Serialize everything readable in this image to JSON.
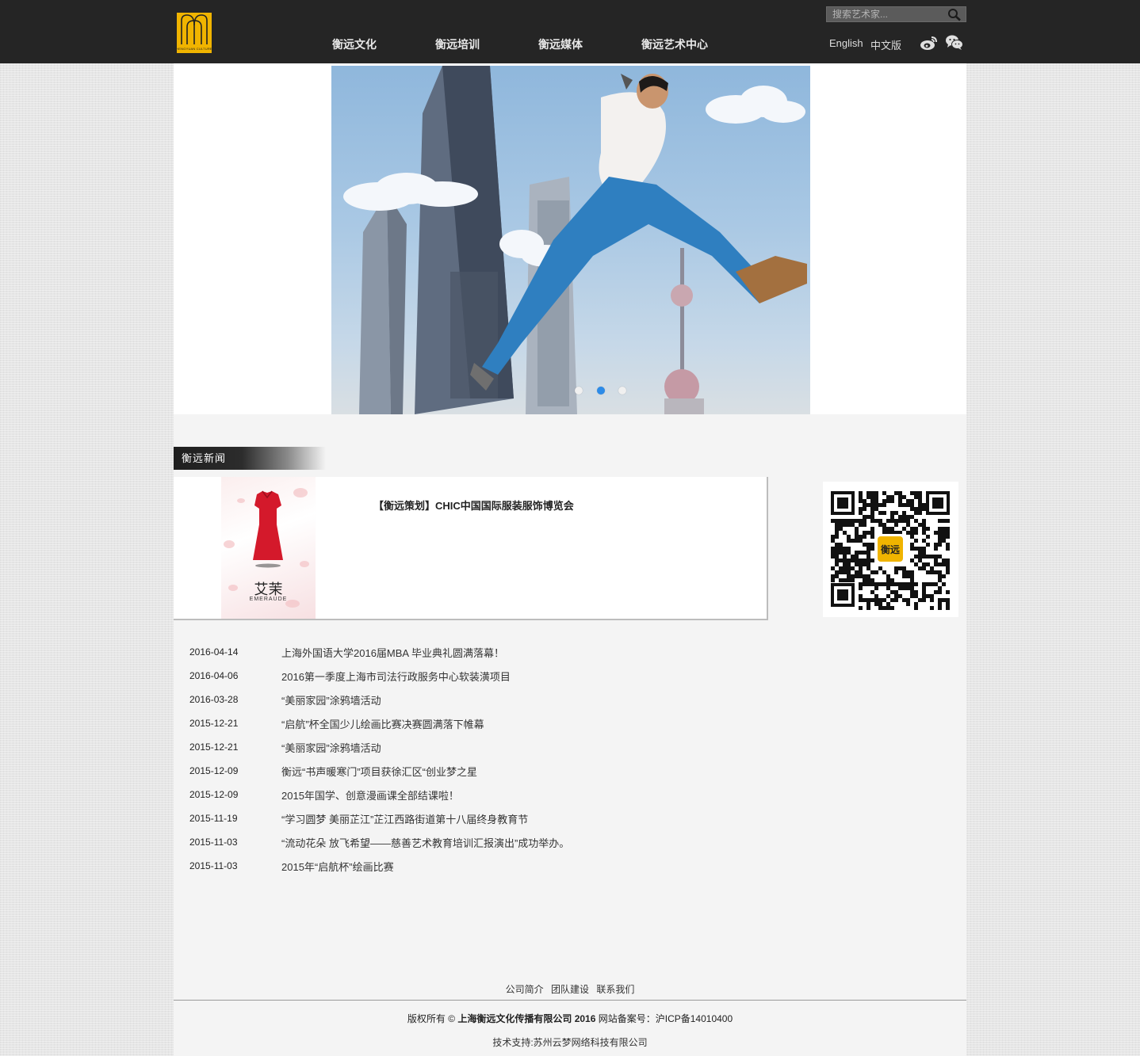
{
  "header": {
    "logo_text": "HENGYUAN CULTURE",
    "nav": [
      "衡远文化",
      "衡远培训",
      "衡远媒体",
      "衡远艺术中心"
    ],
    "search_placeholder": "搜索艺术家...",
    "lang_en": "English",
    "lang_cn": "中文版",
    "social_icons": [
      "weibo-icon",
      "wechat-icon"
    ]
  },
  "banner": {
    "slides": 3,
    "active_slide": 2
  },
  "news": {
    "section_title": "衡远新闻",
    "featured": {
      "title": "【衡远策划】CHIC中国国际服装服饰博览会",
      "image_cn": "艾茉",
      "image_en": "EMERAUDE"
    },
    "qr_center": "衡远",
    "items": [
      {
        "date": "2016-04-14",
        "title": "上海外国语大学2016届MBA 毕业典礼圆满落幕！"
      },
      {
        "date": "2016-04-06",
        "title": "2016第一季度上海市司法行政服务中心软装潢项目"
      },
      {
        "date": "2016-03-28",
        "title": "“美丽家园”涂鸦墙活动"
      },
      {
        "date": "2015-12-21",
        "title": "“启航”杯全国少儿绘画比赛决赛圆满落下帷幕"
      },
      {
        "date": "2015-12-21",
        "title": "“美丽家园”涂鸦墙活动"
      },
      {
        "date": "2015-12-09",
        "title": "衡远“书声暖寒门”项目获徐汇区“创业梦之星"
      },
      {
        "date": "2015-12-09",
        "title": "2015年国学、创意漫画课全部结课啦！"
      },
      {
        "date": "2015-11-19",
        "title": "“学习圆梦 美丽芷江”芷江西路街道第十八届终身教育节"
      },
      {
        "date": "2015-11-03",
        "title": "“流动花朵 放飞希望——慈善艺术教育培训汇报演出”成功举办。"
      },
      {
        "date": "2015-11-03",
        "title": "2015年“启航杯”绘画比赛"
      }
    ]
  },
  "footer": {
    "links": [
      "公司简介",
      "团队建设",
      "联系我们"
    ],
    "copyright_prefix": "版权所有 © ",
    "company": "上海衡远文化传播有限公司 2016",
    "icp": " 网站备案号：沪ICP备14010400",
    "support": "技术支持:苏州云梦网络科技有限公司"
  }
}
